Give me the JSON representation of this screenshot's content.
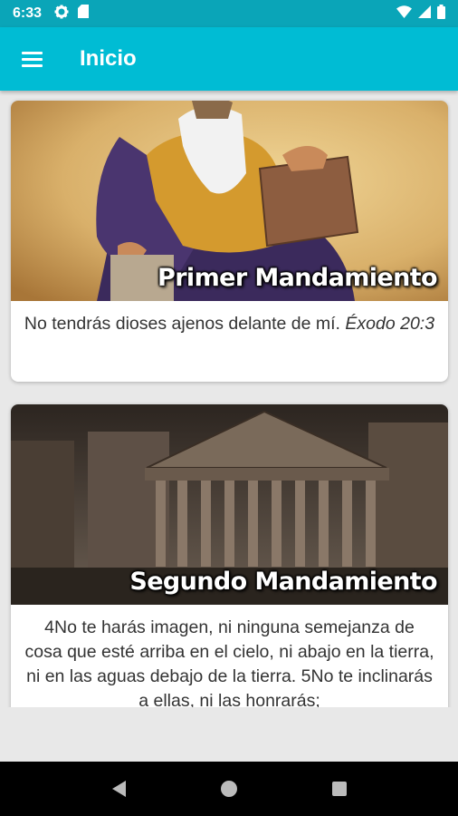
{
  "status_bar": {
    "time": "6:33",
    "left_icons": [
      "gear-icon",
      "sd-card-icon"
    ],
    "right_icons": [
      "wifi-icon",
      "signal-icon",
      "battery-icon"
    ]
  },
  "app_bar": {
    "title": "Inicio",
    "menu_icon": "hamburger-menu-icon",
    "color": "#00bcd4"
  },
  "cards": [
    {
      "title": "Primer Mandamiento",
      "text": "No tendrás dioses ajenos delante de mí.",
      "reference": "Éxodo 20:3",
      "image": "moses-painting"
    },
    {
      "title": "Segundo Mandamiento",
      "text": "4No te harás imagen, ni ninguna semejanza de cosa que esté arriba en el cielo, ni abajo en la tierra, ni en las aguas debajo de la tierra. 5No te inclinarás a ellas, ni las honrarás;",
      "reference": "",
      "image": "pantheon-photo"
    }
  ],
  "nav_bar": {
    "buttons": [
      "back-icon",
      "home-icon",
      "recents-icon"
    ]
  }
}
